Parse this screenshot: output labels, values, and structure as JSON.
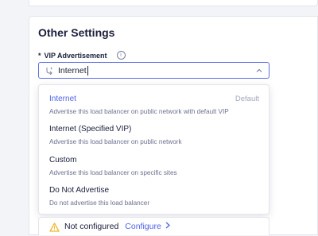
{
  "section": {
    "title": "Other Settings"
  },
  "vip_field": {
    "required_mark": "*",
    "label": "VIP Advertisement",
    "info_icon": "info-icon",
    "value": "Internet",
    "leading_icon": "route-icon",
    "chevron_icon": "chevron-up-icon"
  },
  "dropdown": {
    "options": [
      {
        "title": "Internet",
        "tag": "Default",
        "description": "Advertise this load balancer on public network with default VIP",
        "selected": true
      },
      {
        "title": "Internet (Specified VIP)",
        "description": "Advertise this load balancer on public network"
      },
      {
        "title": "Custom",
        "description": "Advertise this load balancer on specific sites"
      },
      {
        "title": "Do Not Advertise",
        "description": "Do not advertise this load balancer"
      }
    ]
  },
  "status": {
    "icon": "warning-icon",
    "text": "Not configured",
    "link": "Configure",
    "link_icon": "chevron-right-icon"
  },
  "colors": {
    "accent": "#4f63e6",
    "warning": "#f2b630",
    "text": "#1b1f3b",
    "muted": "#6b7090"
  }
}
